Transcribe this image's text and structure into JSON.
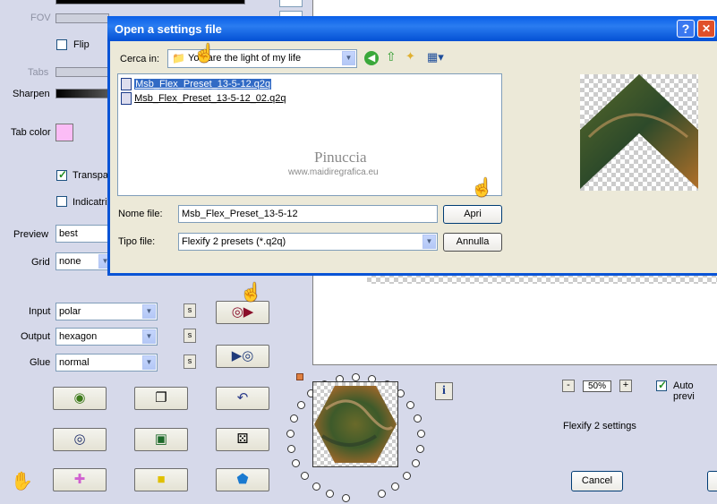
{
  "left_panel": {
    "fov_label": "FOV",
    "flip_label": "Flip",
    "tabs_label": "Tabs",
    "sharpen_label": "Sharpen",
    "tab_color_label": "Tab color",
    "tab_color_value": "#fbbcf6",
    "transparent_label": "Transpa",
    "indicatrix_label": "Indicatrix",
    "preview_label": "Preview",
    "preview_value": "best",
    "grid_label": "Grid",
    "grid_value": "none",
    "input_label": "Input",
    "input_value": "polar",
    "output_label": "Output",
    "output_value": "hexagon",
    "glue_label": "Glue",
    "glue_value": "normal",
    "s_label": "s"
  },
  "right_panel": {
    "zoom_value": "50%",
    "zoom_minus": "-",
    "zoom_plus": "+",
    "auto_preview_label": "Auto previ",
    "settings_label": "Flexify 2 settings",
    "cancel_label": "Cancel",
    "info_label": "i"
  },
  "dialog": {
    "title": "Open a settings file",
    "help_label": "?",
    "close_label": "✕",
    "look_in_label": "Cerca in:",
    "look_in_value": "You are the light of my life",
    "files": [
      "Msb_Flex_Preset_13-5-12.q2q",
      "Msb_Flex_Preset_13-5-12_02.q2q"
    ],
    "watermark_title": "Pinuccia",
    "watermark_url": "www.maidiregrafica.eu",
    "filename_label": "Nome file:",
    "filename_value": "Msb_Flex_Preset_13-5-12",
    "filetype_label": "Tipo file:",
    "filetype_value": "Flexify 2 presets (*.q2q)",
    "open_label": "Apri",
    "cancel_label": "Annulla"
  },
  "colors": {
    "panel_bg": "#d6d9ea",
    "dialog_title_bg": "#0a59e0",
    "selection_bg": "#316ac5",
    "xp_face": "#ece9d8"
  }
}
